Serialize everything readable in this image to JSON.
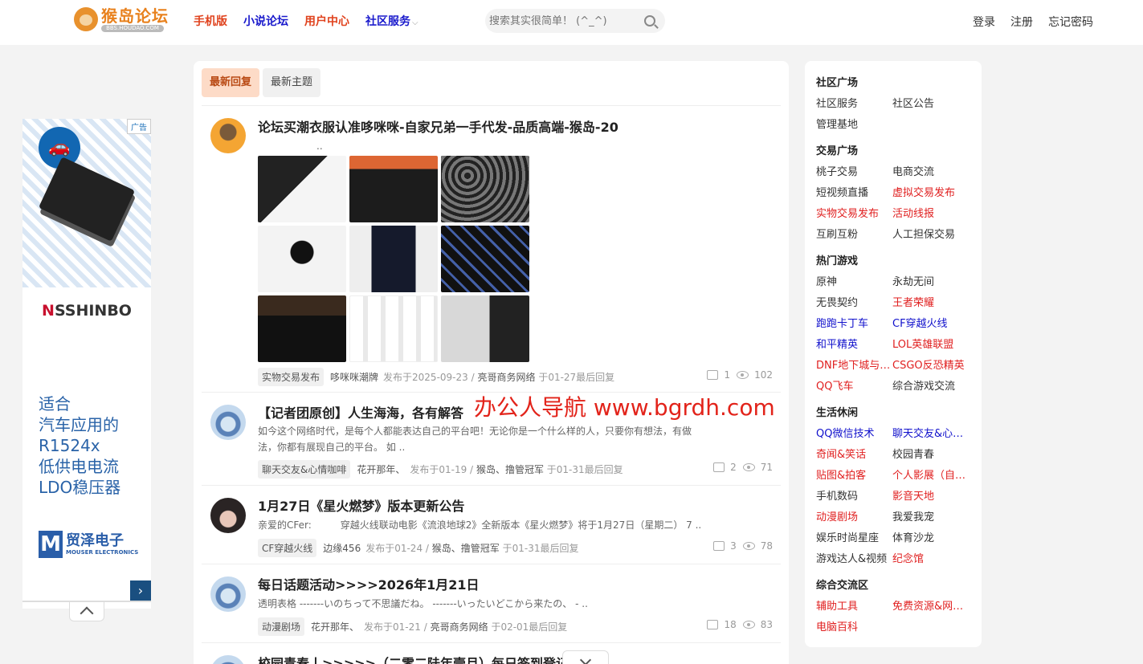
{
  "header": {
    "logo_title": "猴岛论坛",
    "logo_sub": "BBS.HOUDAO.COM",
    "nav": [
      {
        "label": "手机版",
        "color": "#e0421d"
      },
      {
        "label": "小说论坛",
        "color": "#1a1acc"
      },
      {
        "label": "用户中心",
        "color": "#e0421d"
      },
      {
        "label": "社区服务",
        "color": "#1a1acc"
      }
    ],
    "search_placeholder": "搜索其实很简单！ (^_^)",
    "account": [
      "登录",
      "注册",
      "忘记密码"
    ]
  },
  "ad": {
    "badge": "广告",
    "brand_a": "N",
    "brand_b": "SSHINBO",
    "lines": [
      "适合",
      "汽车应用的",
      "R1524x",
      "低供电电流",
      "LDO稳压器"
    ],
    "mouser_cn": "贸泽电子",
    "mouser_en": "MOUSER ELECTRONICS"
  },
  "tabs": [
    "最新回复",
    "最新主题"
  ],
  "posts": [
    {
      "title": "论坛买潮衣服认准哆咪咪-自家兄弟一手代发-品质高端-猴岛-20",
      "excerpt": "..",
      "tag": "实物交易发布",
      "author": "哆咪咪潮牌",
      "posted": "发布于2025-09-23 /",
      "last_user": "亮哥商务网络",
      "last_time": "于01-27最后回复",
      "replies": "1",
      "views": "102"
    },
    {
      "title": "【记者团原创】人生海海，各有解答",
      "excerpt": "如今这个网络时代，是每个人都能表达自己的平台吧！无论你是一个什么样的人，只要你有想法，有做法，你都有展现自己的平台。 如 ..",
      "tag": "聊天交友&心情咖啡",
      "author": "花开那年、",
      "posted": "发布于01-19 /",
      "last_user": "猴岛、撸管冠军",
      "last_time": "于01-31最后回复",
      "replies": "2",
      "views": "71"
    },
    {
      "title": "1月27日《星火燃梦》版本更新公告",
      "excerpt": "亲爱的CFer:　　　穿越火线联动电影《流浪地球2》全新版本《星火燃梦》将于1月27日（星期二） 7 ..",
      "tag": "CF穿越火线",
      "author": "边缘456",
      "posted": "发布于01-24 /",
      "last_user": "猴岛、撸管冠军",
      "last_time": "于01-31最后回复",
      "replies": "3",
      "views": "78"
    },
    {
      "title": "每日话题活动>>>>2026年1月21日",
      "excerpt": "透明表格 -------いのちって不思議だね。 -------いったいどこから来たの、 - ..",
      "tag": "动漫剧场",
      "author": "花开那年、",
      "posted": "发布于01-21 /",
      "last_user": "亮哥商务网络",
      "last_time": "于02-01最后回复",
      "replies": "18",
      "views": "83"
    },
    {
      "title": "校园青春丨>>>>>（二零二陆年壹月）每日签到登记"
    }
  ],
  "watermark": "办公人导航  www.bgrdh.com",
  "sidebar": [
    {
      "title": "社区广场",
      "links": [
        {
          "t": "社区服务",
          "c": "d"
        },
        {
          "t": "社区公告",
          "c": "d"
        },
        {
          "t": "管理基地",
          "c": "d"
        }
      ]
    },
    {
      "title": "交易广场",
      "links": [
        {
          "t": "桃子交易",
          "c": "d"
        },
        {
          "t": "电商交流",
          "c": "d"
        },
        {
          "t": "短视频直播",
          "c": "d"
        },
        {
          "t": "虚拟交易发布",
          "c": "r"
        },
        {
          "t": "实物交易发布",
          "c": "r"
        },
        {
          "t": "活动线报",
          "c": "r"
        },
        {
          "t": "互刷互粉",
          "c": "d"
        },
        {
          "t": "人工担保交易",
          "c": "d"
        }
      ]
    },
    {
      "title": "热门游戏",
      "links": [
        {
          "t": "原神",
          "c": "d"
        },
        {
          "t": "永劫无间",
          "c": "d"
        },
        {
          "t": "无畏契约",
          "c": "d"
        },
        {
          "t": "王者荣耀",
          "c": "r"
        },
        {
          "t": "跑跑卡丁车",
          "c": "b"
        },
        {
          "t": "CF穿越火线",
          "c": "b"
        },
        {
          "t": "和平精英",
          "c": "b"
        },
        {
          "t": "LOL英雄联盟",
          "c": "r"
        },
        {
          "t": "DNF地下城与勇士",
          "c": "r"
        },
        {
          "t": "CSGO反恐精英",
          "c": "r"
        },
        {
          "t": "QQ飞车",
          "c": "r"
        },
        {
          "t": "综合游戏交流",
          "c": "d"
        }
      ]
    },
    {
      "title": "生活休闲",
      "links": [
        {
          "t": "QQ微信技术",
          "c": "b"
        },
        {
          "t": "聊天交友&心情咖啡",
          "c": "b"
        },
        {
          "t": "奇闻&笑话",
          "c": "r"
        },
        {
          "t": "校园青春",
          "c": "d"
        },
        {
          "t": "贴图&拍客",
          "c": "r"
        },
        {
          "t": "个人影展（自拍）",
          "c": "r"
        },
        {
          "t": "手机数码",
          "c": "d"
        },
        {
          "t": "影音天地",
          "c": "r"
        },
        {
          "t": "动漫剧场",
          "c": "r"
        },
        {
          "t": "我爱我宠",
          "c": "d"
        },
        {
          "t": "娱乐时尚星座",
          "c": "d"
        },
        {
          "t": "体育沙龙",
          "c": "d"
        },
        {
          "t": "游戏达人&视频",
          "c": "d"
        },
        {
          "t": "纪念馆",
          "c": "r"
        }
      ]
    },
    {
      "title": "综合交流区",
      "links": [
        {
          "t": "辅助工具",
          "c": "r"
        },
        {
          "t": "免费资源&网赚项目",
          "c": "r"
        },
        {
          "t": "电脑百科",
          "c": "r"
        }
      ]
    }
  ]
}
